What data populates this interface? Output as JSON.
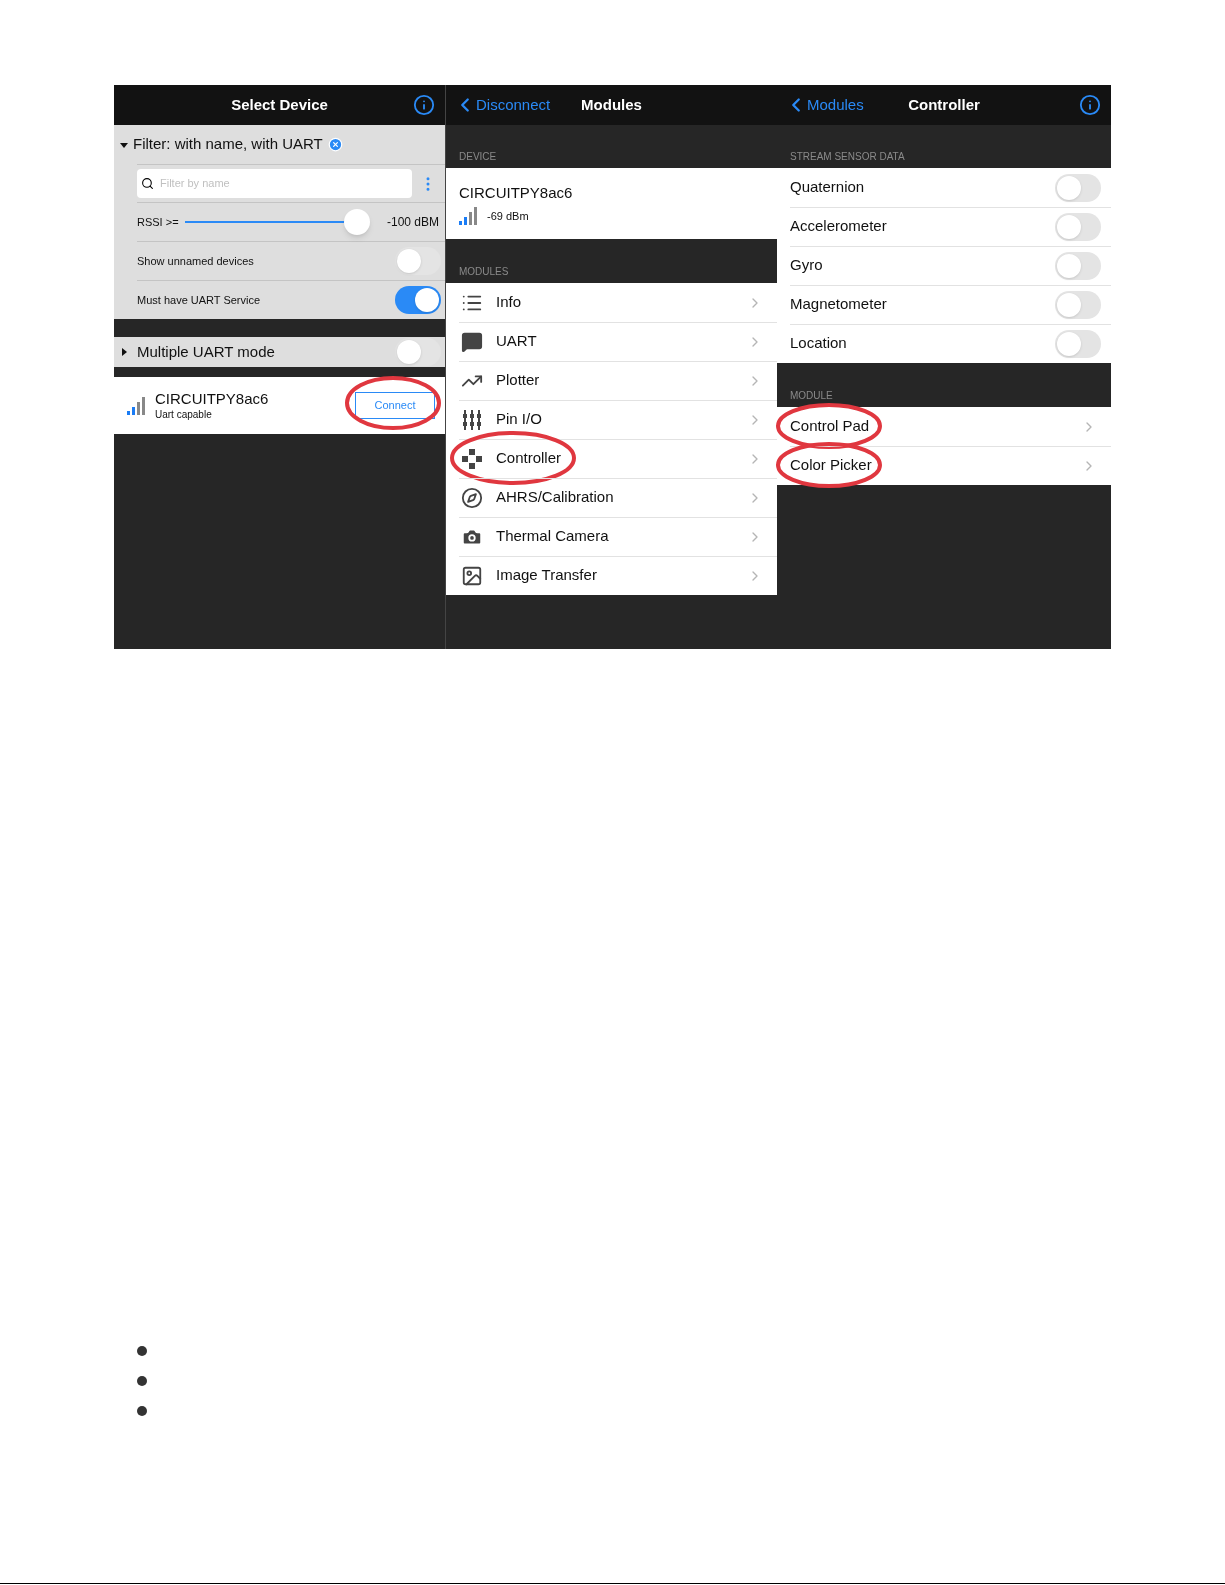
{
  "select_device": {
    "title": "Select Device",
    "filter": {
      "label": "Filter: with name, with UART",
      "expanded": true
    },
    "search": {
      "placeholder": "Filter by name"
    },
    "rssi": {
      "label": "RSSI >=",
      "level": 0.94,
      "reading": "-100 dBM"
    },
    "toggles": [
      {
        "label": "Show unnamed devices",
        "on": false
      },
      {
        "label": "Must have UART Service",
        "on": true
      }
    ],
    "multiple_uart": {
      "label": "Multiple UART mode",
      "expanded": false,
      "on": false
    },
    "device": {
      "name": "CIRCUITPY8ac6",
      "subtitle": "Uart capable",
      "button": "Connect",
      "highlighted": true
    }
  },
  "modules": {
    "back": "Disconnect",
    "title": "Modules",
    "device_header": "DEVICE",
    "device": {
      "name": "CIRCUITPY8ac6",
      "rssi": "-69 dBm"
    },
    "modules_header": "MODULES",
    "items": [
      {
        "label": "Info",
        "highlighted": false
      },
      {
        "label": "UART",
        "highlighted": false
      },
      {
        "label": "Plotter",
        "highlighted": false
      },
      {
        "label": "Pin I/O",
        "highlighted": false
      },
      {
        "label": "Controller",
        "highlighted": true
      },
      {
        "label": "AHRS/Calibration",
        "highlighted": false
      },
      {
        "label": "Thermal Camera",
        "highlighted": false
      },
      {
        "label": "Image Transfer",
        "highlighted": false
      }
    ]
  },
  "controller": {
    "back": "Modules",
    "title": "Controller",
    "stream_header": "STREAM SENSOR DATA",
    "sensors": [
      {
        "label": "Quaternion",
        "on": false
      },
      {
        "label": "Accelerometer",
        "on": false
      },
      {
        "label": "Gyro",
        "on": false
      },
      {
        "label": "Magnetometer",
        "on": false
      },
      {
        "label": "Location",
        "on": false
      }
    ],
    "module_header": "MODULE",
    "modules": [
      {
        "label": "Control Pad",
        "highlighted": true
      },
      {
        "label": "Color Picker",
        "highlighted": true
      }
    ]
  },
  "bullets": [
    {
      "kind": "empty"
    },
    {
      "kind": "empty"
    },
    {
      "kind": "empty"
    }
  ]
}
